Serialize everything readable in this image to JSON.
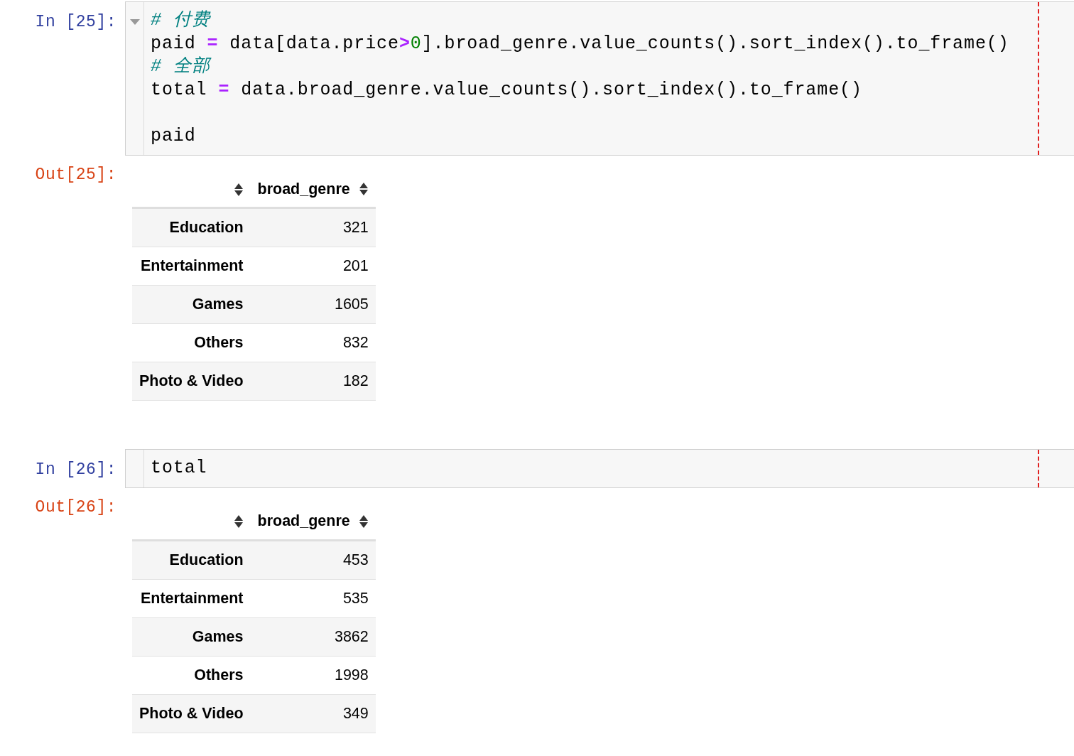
{
  "cells": [
    {
      "in_prompt": "In [25]:",
      "collapsible": true,
      "lines": [
        {
          "kind": "code",
          "tokens": [
            {
              "kind": "comment",
              "text": "# 付费"
            }
          ]
        },
        {
          "kind": "code",
          "tokens": [
            {
              "kind": "plain",
              "text": "paid "
            },
            {
              "kind": "op",
              "text": "="
            },
            {
              "kind": "plain",
              "text": " data[data.price"
            },
            {
              "kind": "op",
              "text": ">"
            },
            {
              "kind": "number",
              "text": "0"
            },
            {
              "kind": "plain",
              "text": "].broad_genre.value_counts().sort_index().to_frame()"
            }
          ]
        },
        {
          "kind": "code",
          "tokens": [
            {
              "kind": "comment",
              "text": "# 全部"
            }
          ]
        },
        {
          "kind": "code",
          "tokens": [
            {
              "kind": "plain",
              "text": "total "
            },
            {
              "kind": "op",
              "text": "="
            },
            {
              "kind": "plain",
              "text": " data.broad_genre.value_counts().sort_index().to_frame()"
            }
          ]
        },
        {
          "kind": "blank"
        },
        {
          "kind": "code",
          "tokens": [
            {
              "kind": "plain",
              "text": "paid"
            }
          ]
        }
      ],
      "out_prompt": "Out[25]:",
      "table": {
        "column": "broad_genre",
        "rows": [
          {
            "index": "Education",
            "value": "321"
          },
          {
            "index": "Entertainment",
            "value": "201"
          },
          {
            "index": "Games",
            "value": "1605"
          },
          {
            "index": "Others",
            "value": "832"
          },
          {
            "index": "Photo & Video",
            "value": "182"
          }
        ]
      }
    },
    {
      "in_prompt": "In [26]:",
      "collapsible": false,
      "lines": [
        {
          "kind": "code",
          "tokens": [
            {
              "kind": "plain",
              "text": "total"
            }
          ]
        }
      ],
      "out_prompt": "Out[26]:",
      "table": {
        "column": "broad_genre",
        "rows": [
          {
            "index": "Education",
            "value": "453"
          },
          {
            "index": "Entertainment",
            "value": "535"
          },
          {
            "index": "Games",
            "value": "3862"
          },
          {
            "index": "Others",
            "value": "1998"
          },
          {
            "index": "Photo & Video",
            "value": "349"
          }
        ]
      }
    }
  ]
}
